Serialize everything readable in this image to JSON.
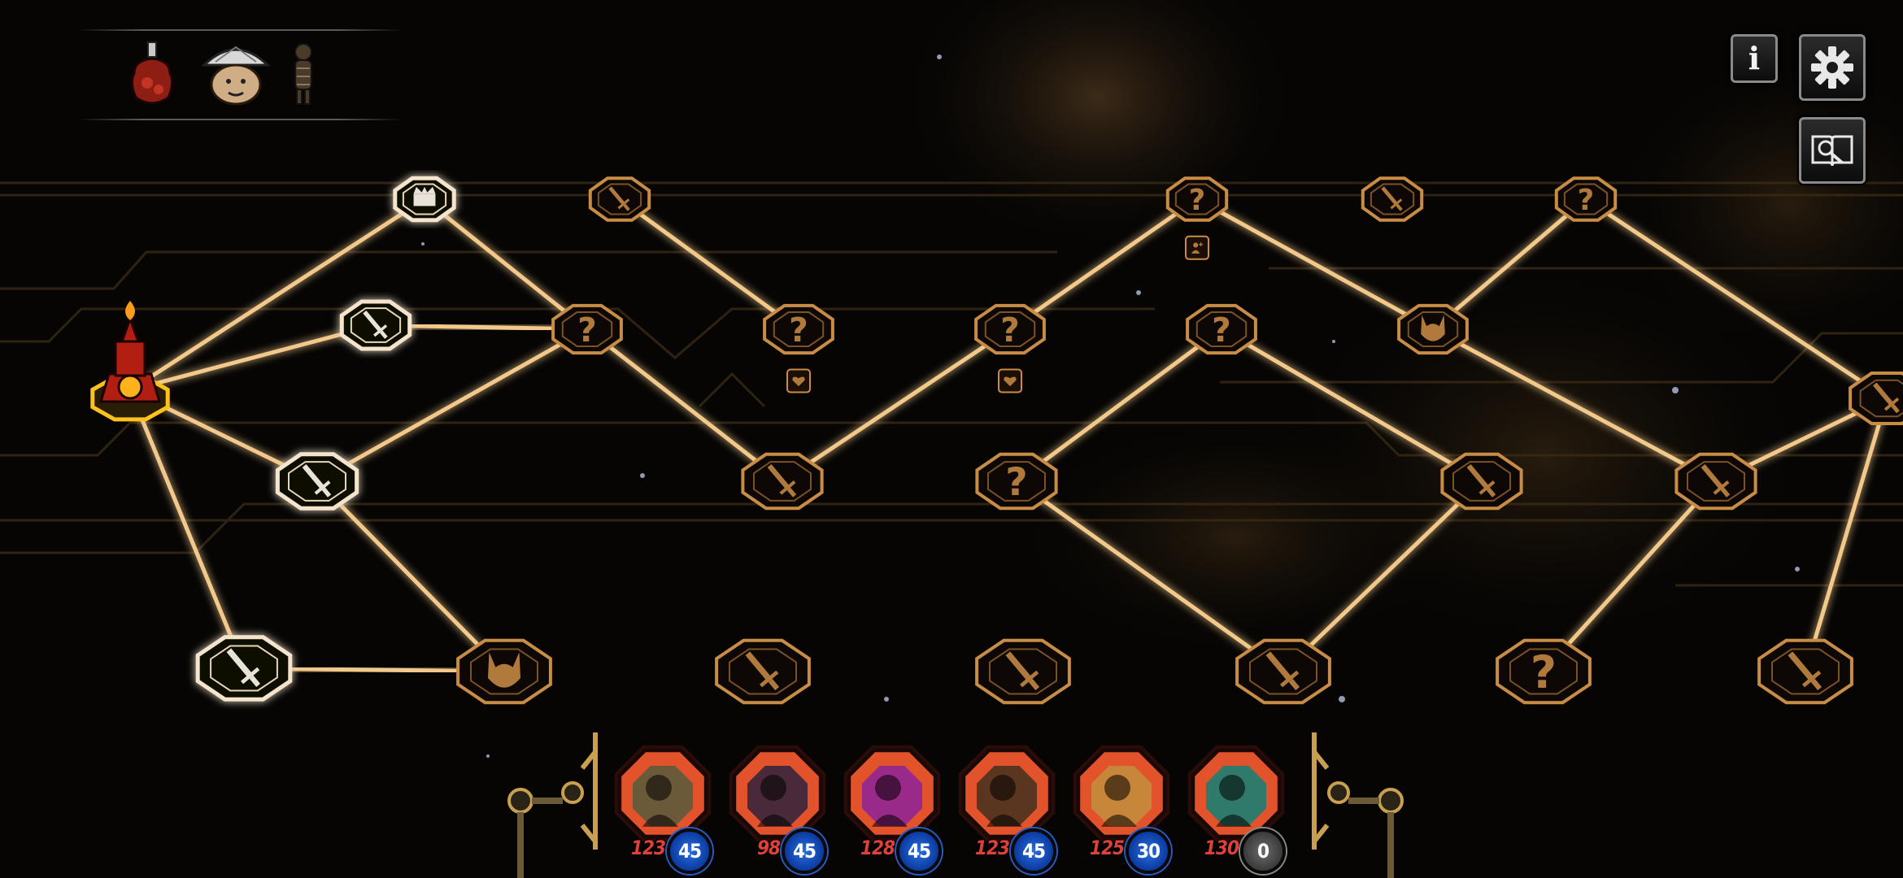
{
  "colors": {
    "path_glow": "#f3c98b",
    "node_fill": "#0d0805",
    "node_border": "#c98c45",
    "visited_border": "#f4e4cc",
    "current_marker": "#b31e12",
    "hero_frame": "#e2532b",
    "energy_blue": "#1f5ed0"
  },
  "header": {
    "relics": [
      {
        "name": "perfume-bottle-relic-icon"
      },
      {
        "name": "umbrella-relic-icon"
      },
      {
        "name": "voodoo-doll-relic-icon"
      }
    ],
    "buttons": {
      "info": {
        "icon": "info-icon",
        "label": "i"
      },
      "settings": {
        "icon": "gear-icon"
      },
      "log": {
        "icon": "book-search-icon"
      }
    }
  },
  "map": {
    "current_node": "start",
    "nodes": [
      {
        "id": "start",
        "type": "current",
        "icon": "red-shrine-icon"
      },
      {
        "id": "a1",
        "type": "elite",
        "icon": "chest-icon",
        "visited": true
      },
      {
        "id": "a2",
        "type": "battle",
        "icon": "sword-icon",
        "visited": true
      },
      {
        "id": "a3",
        "type": "battle",
        "icon": "sword-icon",
        "visited": true
      },
      {
        "id": "a4",
        "type": "battle",
        "icon": "sword-icon",
        "visited": true
      },
      {
        "id": "b1",
        "type": "battle",
        "icon": "sword-icon"
      },
      {
        "id": "b2",
        "type": "unknown",
        "icon": "question-icon",
        "label": "?"
      },
      {
        "id": "b3",
        "type": "boss",
        "icon": "horned-mask-icon"
      },
      {
        "id": "c2",
        "type": "unknown",
        "icon": "question-icon",
        "label": "?",
        "badge": "heart-icon"
      },
      {
        "id": "c3",
        "type": "battle",
        "icon": "sword-icon"
      },
      {
        "id": "c4",
        "type": "battle",
        "icon": "sword-icon"
      },
      {
        "id": "d2",
        "type": "unknown",
        "icon": "question-icon",
        "label": "?",
        "badge": "heart-icon"
      },
      {
        "id": "d3",
        "type": "unknown",
        "icon": "question-icon",
        "label": "?"
      },
      {
        "id": "d4",
        "type": "battle",
        "icon": "sword-icon"
      },
      {
        "id": "e1",
        "type": "unknown",
        "icon": "question-icon",
        "label": "?",
        "badge": "person-plus-icon"
      },
      {
        "id": "e2",
        "type": "unknown",
        "icon": "question-icon",
        "label": "?"
      },
      {
        "id": "e4",
        "type": "battle",
        "icon": "sword-icon"
      },
      {
        "id": "f1",
        "type": "battle",
        "icon": "sword-icon"
      },
      {
        "id": "f2",
        "type": "boss",
        "icon": "horned-mask-icon"
      },
      {
        "id": "f3",
        "type": "battle",
        "icon": "sword-icon"
      },
      {
        "id": "f4",
        "type": "unknown",
        "icon": "question-icon",
        "label": "?"
      },
      {
        "id": "g1",
        "type": "unknown",
        "icon": "question-icon",
        "label": "?"
      },
      {
        "id": "g3",
        "type": "battle",
        "icon": "sword-icon"
      },
      {
        "id": "g4",
        "type": "battle",
        "icon": "sword-icon"
      },
      {
        "id": "h2",
        "type": "battle",
        "icon": "sword-icon"
      }
    ]
  },
  "party": {
    "heroes": [
      {
        "name": "hero-1",
        "hp": "123",
        "energy": "45",
        "portrait": "#6b5a3a"
      },
      {
        "name": "hero-2",
        "hp": "98",
        "energy": "45",
        "portrait": "#4a2a3a"
      },
      {
        "name": "hero-3",
        "hp": "128",
        "energy": "45",
        "portrait": "#9a2a8a"
      },
      {
        "name": "hero-4",
        "hp": "123",
        "energy": "45",
        "portrait": "#5a3520"
      },
      {
        "name": "hero-5",
        "hp": "125",
        "energy": "30",
        "portrait": "#c8863a"
      },
      {
        "name": "hero-6",
        "hp": "130",
        "energy": "0",
        "portrait": "#2f7a6a"
      }
    ]
  }
}
